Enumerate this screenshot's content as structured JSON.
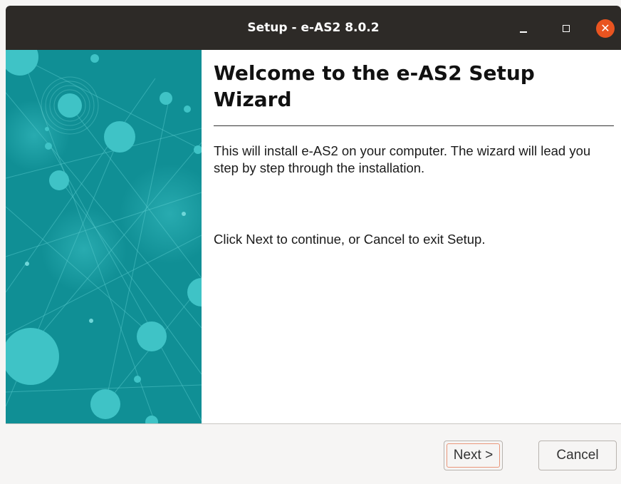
{
  "window": {
    "title": "Setup - e-AS2 8.0.2",
    "controls": {
      "minimize": "–",
      "maximize": "□",
      "close": "✕"
    }
  },
  "wizard": {
    "heading": "Welcome to the e-AS2 Setup Wizard",
    "paragraph1": "This will install e-AS2 on your computer. The wizard will lead you step by step through the installation.",
    "paragraph2": "Click Next to continue, or Cancel to exit Setup."
  },
  "buttons": {
    "next": "Next >",
    "cancel": "Cancel"
  },
  "colors": {
    "titlebar": "#2d2a27",
    "close_button": "#e95420",
    "side_image": "#108f95",
    "focus_ring": "#e9967a"
  }
}
